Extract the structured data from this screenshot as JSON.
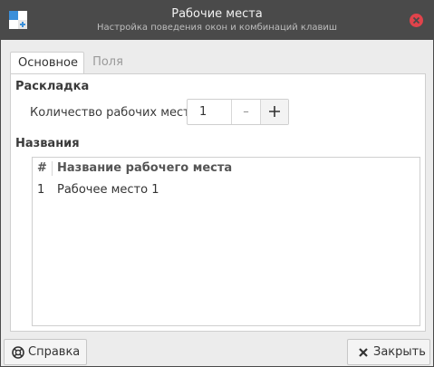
{
  "window": {
    "title": "Рабочие места",
    "subtitle": "Настройка поведения окон и комбинаций клавиш"
  },
  "tabs": [
    {
      "label": "Основное",
      "active": true
    },
    {
      "label": "Поля",
      "active": false
    }
  ],
  "layout_section": {
    "title": "Раскладка",
    "count_label": "Количество рабочих мест:",
    "count_value": "1",
    "minus_label": "–",
    "plus_label": "+"
  },
  "names_section": {
    "title": "Названия",
    "columns": [
      "#",
      "Название рабочего места"
    ],
    "rows": [
      {
        "num": "1",
        "name": "Рабочее место 1"
      }
    ]
  },
  "buttons": {
    "help": "Справка",
    "close": "Закрыть"
  },
  "colors": {
    "titlebar": "#4a4a4a",
    "close_red": "#e0434b",
    "panel_bg": "#ffffff",
    "window_bg": "#ececec"
  },
  "icons": {
    "app": "workspace-settings-icon",
    "close": "close-icon",
    "help": "help-lifebuoy-icon",
    "close_btn": "close-x-icon"
  }
}
